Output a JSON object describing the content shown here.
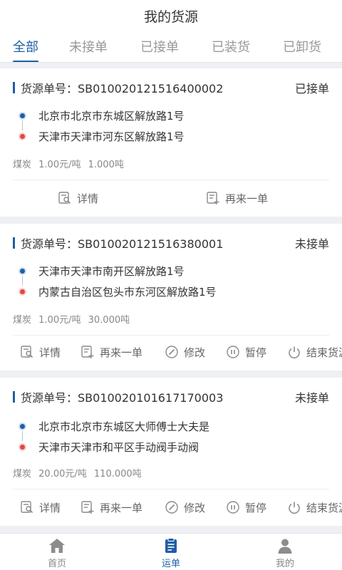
{
  "header": {
    "title": "我的货源"
  },
  "tabs": [
    {
      "label": "全部",
      "active": true
    },
    {
      "label": "未接单",
      "active": false
    },
    {
      "label": "已接单",
      "active": false
    },
    {
      "label": "已装货",
      "active": false
    },
    {
      "label": "已卸货",
      "active": false
    }
  ],
  "cards": [
    {
      "order_label": "货源单号：SB010020121516400002",
      "status": "已接单",
      "from": "北京市北京市东城区解放路1号",
      "to": "天津市天津市河东区解放路1号",
      "cargo": "煤炭",
      "price": "1.00元/吨",
      "weight": "1.000吨",
      "actions": {
        "detail": "详情",
        "again": "再来一单"
      }
    },
    {
      "order_label": "货源单号：SB010020121516380001",
      "status": "未接单",
      "from": "天津市天津市南开区解放路1号",
      "to": "内蒙古自治区包头市东河区解放路1号",
      "cargo": "煤炭",
      "price": "1.00元/吨",
      "weight": "30.000吨",
      "actions": {
        "detail": "详情",
        "again": "再来一单",
        "edit": "修改",
        "pause": "暂停",
        "end": "结束货源"
      }
    },
    {
      "order_label": "货源单号：SB010020101617170003",
      "status": "未接单",
      "from": "北京市北京市东城区大师傅士大夫是",
      "to": "天津市天津市和平区手动阀手动阀",
      "cargo": "煤炭",
      "price": "20.00元/吨",
      "weight": "110.000吨",
      "actions": {
        "detail": "详情",
        "again": "再来一单",
        "edit": "修改",
        "pause": "暂停",
        "end": "结束货源"
      }
    }
  ],
  "nav": [
    {
      "label": "首页",
      "icon": "home-icon",
      "active": false
    },
    {
      "label": "运单",
      "icon": "waybill-icon",
      "active": true
    },
    {
      "label": "我的",
      "icon": "user-icon",
      "active": false
    }
  ],
  "colors": {
    "accent": "#1f5fa6",
    "origin_dot": "#1f5fa6",
    "dest_dot": "#e64545"
  }
}
